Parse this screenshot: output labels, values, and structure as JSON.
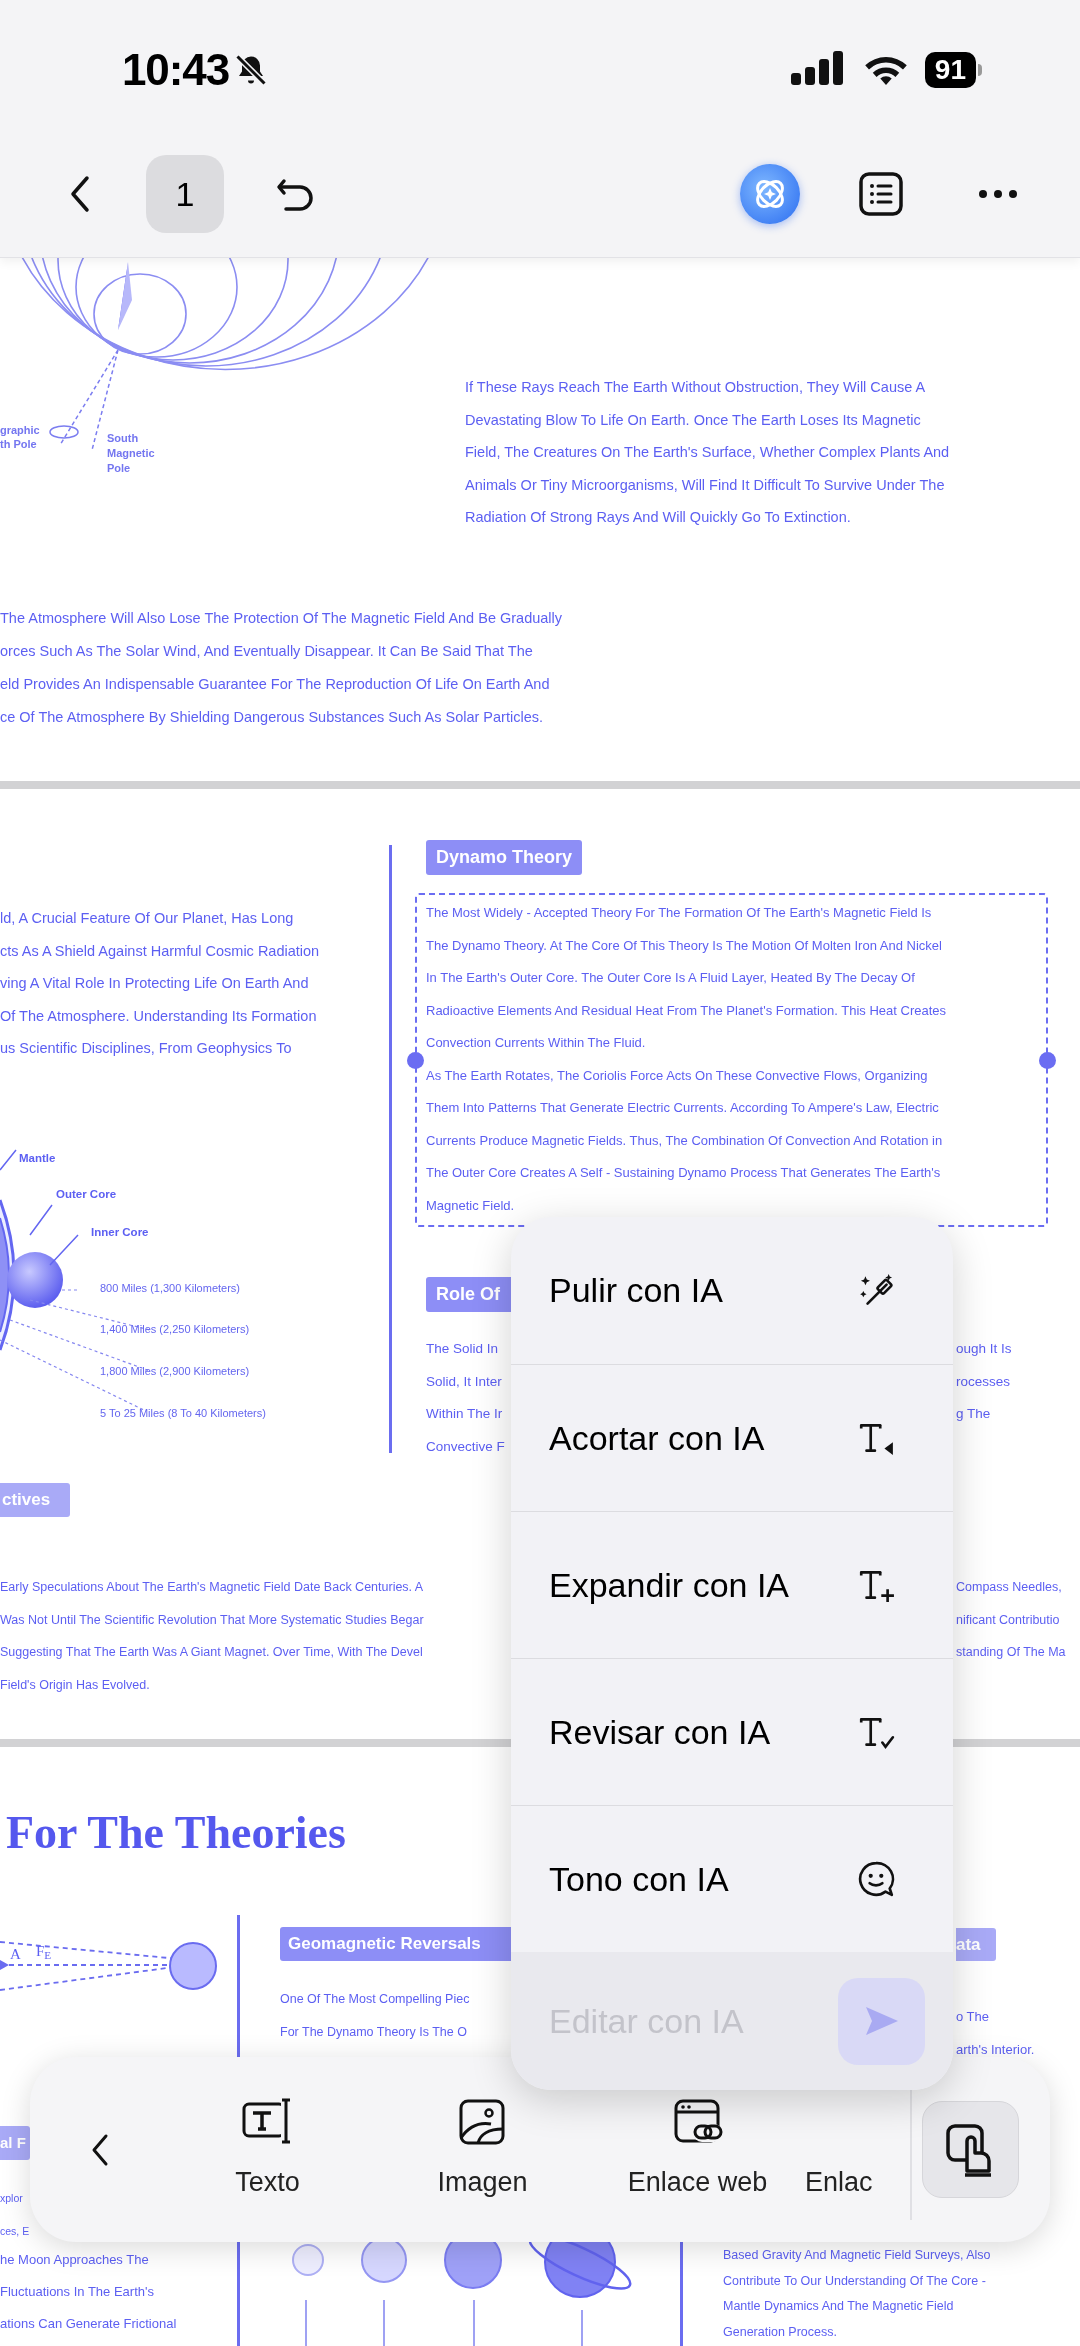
{
  "status_bar": {
    "time": "10:43",
    "battery": "91"
  },
  "nav_bar": {
    "page": "1"
  },
  "page_1": {
    "diagram_labels": [
      "graphic",
      "th Pole",
      "South",
      "Magnetic",
      "Pole"
    ],
    "right_paragraph": [
      "If These Rays Reach The Earth Without Obstruction, They Will Cause A",
      "Devastating Blow To Life On Earth. Once The Earth Loses Its Magnetic",
      "Field, The Creatures On The Earth's Surface, Whether Complex Plants And",
      "Animals Or Tiny Microorganisms, Will Find It Difficult To Survive Under The",
      "Radiation Of Strong Rays And Will Quickly Go To Extinction."
    ],
    "left_paragraph": [
      "The Atmosphere Will Also Lose The Protection Of The Magnetic Field And Be Gradually",
      "orces Such As The Solar Wind, And Eventually Disappear. It Can Be Said That The",
      "eld Provides An Indispensable Guarantee For The Reproduction Of Life On Earth And",
      "ce Of The Atmosphere By Shielding Dangerous Substances Such As Solar Particles."
    ]
  },
  "page_2": {
    "intro_lines": [
      "ld, A Crucial Feature Of Our Planet, Has Long",
      "cts As A Shield Against Harmful Cosmic Radiation",
      "ving A Vital Role In Protecting Life On Earth And",
      "Of The Atmosphere. Understanding Its Formation",
      "us Scientific Disciplines, From Geophysics To"
    ],
    "diagram_labels": [
      "Mantle",
      "Outer Core",
      "Inner Core"
    ],
    "distance_labels": [
      "800 Miles (1,300 Kilometers)",
      "1,400 Miles (2,250 Kilometers)",
      "1,800 Miles (2,900 Kilometers)",
      "5 To 25 Miles (8 To 40 Kilometers)"
    ],
    "dynamo": {
      "tag": "Dynamo Theory",
      "selected": true,
      "lines": [
        "The Most Widely - Accepted Theory For The Formation Of The Earth's Magnetic Field Is",
        "The Dynamo Theory. At The Core Of This Theory Is The Motion Of Molten Iron And Nickel",
        "In The Earth's Outer Core. The Outer Core Is A Fluid Layer, Heated By The Decay Of",
        "Radioactive Elements And Residual Heat From The Planet's Formation. This Heat Creates",
        "Convection Currents Within The Fluid.",
        "As The Earth Rotates, The Coriolis Force Acts On These Convective Flows, Organizing",
        "Them Into Patterns That Generate Electric Currents. According To Ampere's Law, Electric",
        "Currents Produce Magnetic Fields. Thus, The Combination Of Convection And Rotation in",
        "The Outer Core Creates A Self - Sustaining Dynamo Process That Generates The Earth's",
        "Magnetic Field."
      ]
    },
    "role": {
      "tag": "Role Of",
      "left_lines": [
        "The Solid In",
        "Solid, It Inter",
        "Within The Ir",
        "Convective F"
      ],
      "right_lines": [
        "ough It Is",
        "rocesses",
        "g The"
      ]
    },
    "perspectives": {
      "tag": "ctives",
      "left_lines": [
        "Early Speculations About The Earth's Magnetic Field Date Back Centuries. A",
        "Was Not Until The Scientific Revolution That More Systematic Studies Begar",
        "Suggesting That The Earth Was A Giant Magnet. Over Time, With The Devel",
        "Field's Origin Has Evolved."
      ],
      "right_lines": [
        "Compass Needles,",
        "nificant Contributio",
        "standing Of The Ma"
      ]
    }
  },
  "page_3": {
    "title": "For The Theories",
    "diagram_labels": [
      "A",
      "F$_{E}$"
    ],
    "reversals": {
      "tag": "Geomagnetic Reversals",
      "lines": [
        "One Of The Most Compelling Piec",
        "For The Dynamo Theory Is The O"
      ]
    },
    "right_section": {
      "tag": "ata",
      "lines": [
        "o The",
        "arth's Interior."
      ]
    },
    "left_section": {
      "tag": "al F",
      "side_lines": [
        "xplor",
        "ces, E"
      ],
      "lines": [
        "he Moon Approaches The",
        "Fluctuations In The Earth's",
        "ations Can Generate Frictional"
      ]
    },
    "right_lower_lines": [
      "Based Gravity And Magnetic Field Surveys, Also",
      "Contribute To Our Understanding Of The Core -",
      "Mantle Dynamics And The Magnetic Field",
      "Generation Process."
    ]
  },
  "ai_menu": {
    "items": [
      {
        "kind": "polish",
        "label": "Pulir con IA"
      },
      {
        "kind": "shorten",
        "label": "Acortar con IA"
      },
      {
        "kind": "expand",
        "label": "Expandir con IA"
      },
      {
        "kind": "revise",
        "label": "Revisar con IA"
      },
      {
        "kind": "tone",
        "label": "Tono con IA"
      }
    ],
    "input": {
      "placeholder": "Editar con IA"
    }
  },
  "bottom_toolbar": {
    "items": [
      {
        "kind": "text",
        "label": "Texto"
      },
      {
        "kind": "image",
        "label": "Imagen"
      },
      {
        "kind": "weblink",
        "label": "Enlace web"
      },
      {
        "kind": "link",
        "label": "Enlac"
      }
    ]
  }
}
